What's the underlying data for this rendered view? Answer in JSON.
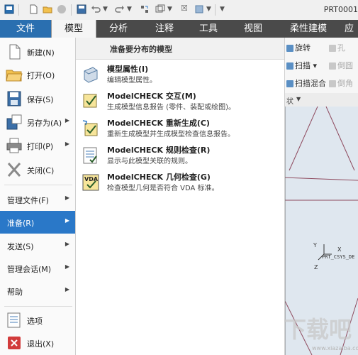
{
  "window": {
    "title": "PRT0001"
  },
  "quick_access": {
    "icons": [
      "new-icon",
      "open-icon",
      "close-window-icon",
      "save-icon",
      "undo-icon",
      "redo-icon",
      "regenerate-icon",
      "window-icon",
      "close-icon",
      "view-icon",
      "customize-icon"
    ]
  },
  "ribbon": {
    "tabs": [
      {
        "label": "文件"
      },
      {
        "label": "模型"
      },
      {
        "label": "分析"
      },
      {
        "label": "注释"
      },
      {
        "label": "工具"
      },
      {
        "label": "视图"
      },
      {
        "label": "柔性建模"
      },
      {
        "label": "应"
      }
    ],
    "content": {
      "revolve": "旋转",
      "hole": "孔",
      "sweep": "扫描",
      "round": "倒圆",
      "swept_blend": "扫描混合",
      "chamfer": "倒角",
      "shape_group": "状"
    }
  },
  "file_menu": {
    "items": [
      {
        "label": "新建(N)",
        "icon": "new-file-icon"
      },
      {
        "label": "打开(O)",
        "icon": "open-folder-icon"
      },
      {
        "label": "保存(S)",
        "icon": "save-disk-icon"
      },
      {
        "label": "另存为(A)",
        "icon": "save-as-icon"
      },
      {
        "label": "打印(P)",
        "icon": "printer-icon"
      },
      {
        "label": "关闭(C)",
        "icon": "close-x-icon"
      }
    ],
    "submenus": [
      {
        "label": "管理文件(F)"
      },
      {
        "label": "准备(R)"
      },
      {
        "label": "发送(S)"
      },
      {
        "label": "管理会话(M)"
      },
      {
        "label": "帮助"
      }
    ],
    "options": {
      "label": "选项"
    },
    "exit": {
      "label": "退出(X)"
    }
  },
  "prepare_submenu": {
    "title": "准备要分布的模型",
    "items": [
      {
        "title": "模型属性(I)",
        "desc": "编辑模型属性。"
      },
      {
        "title": "ModelCHECK 交互(M)",
        "desc": "生成模型信息报告 (零件、装配或绘图)。"
      },
      {
        "title": "ModelCHECK 重新生成(C)",
        "desc": "重新生成模型并生成模型检查信息报告。"
      },
      {
        "title": "ModelCHECK 规则检查(R)",
        "desc": "显示与此模型关联的规则。"
      },
      {
        "title": "ModelCHECK 几何检查(G)",
        "desc": "检查模型几何是否符合 VDA 标准。"
      }
    ]
  },
  "graphics": {
    "csys_label": "PRT_CSYS_DE",
    "axis_x": "X",
    "axis_y": "Y",
    "axis_z": "Z"
  },
  "watermark": {
    "text": "下载吧",
    "url": "www.xiazaiba.com"
  },
  "colors": {
    "accent": "#2a78c8",
    "tab_bar": "#4a4a4a",
    "file_tab": "#2a6fb0",
    "model_lines": "#8e4a5e"
  }
}
